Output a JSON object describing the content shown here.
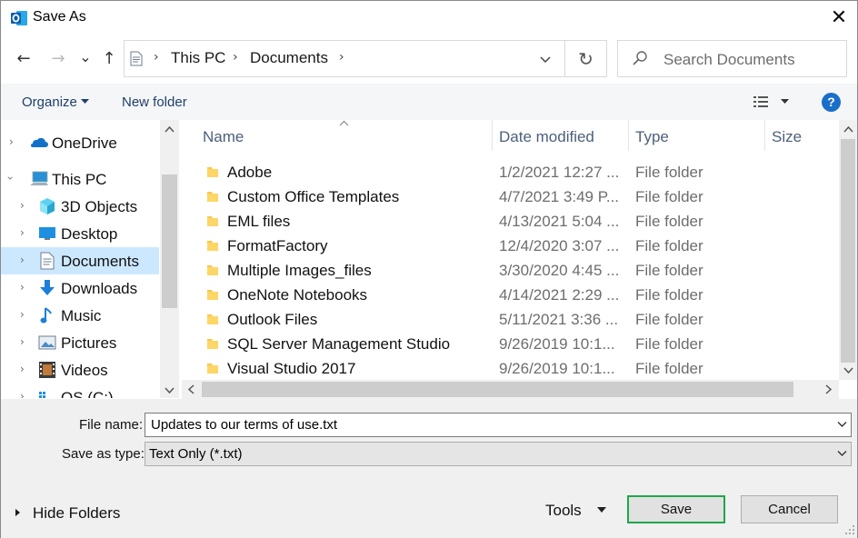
{
  "window": {
    "title": "Save As"
  },
  "nav": {
    "back_glyph": "←",
    "forward_glyph": "→",
    "recent_glyph": "⌄",
    "up_glyph": "↑",
    "refresh_glyph": "↻",
    "close_glyph": "✕"
  },
  "address": {
    "crumbs": [
      "This PC",
      "Documents"
    ],
    "separator": "›"
  },
  "search": {
    "placeholder": "Search Documents"
  },
  "commandbar": {
    "organize": "Organize",
    "new_folder": "New folder",
    "help": "?"
  },
  "navpane": {
    "items": [
      {
        "label": "OneDrive",
        "icon": "cloud-icon"
      },
      {
        "label": "This PC",
        "icon": "computer-icon"
      },
      {
        "label": "3D Objects",
        "icon": "cube-icon"
      },
      {
        "label": "Desktop",
        "icon": "desktop-icon"
      },
      {
        "label": "Documents",
        "icon": "document-icon",
        "selected": true
      },
      {
        "label": "Downloads",
        "icon": "download-arrow-icon"
      },
      {
        "label": "Music",
        "icon": "music-note-icon"
      },
      {
        "label": "Pictures",
        "icon": "picture-icon"
      },
      {
        "label": "Videos",
        "icon": "film-icon"
      },
      {
        "label": "OS (C:)",
        "icon": "drive-icon"
      }
    ]
  },
  "filelist": {
    "columns": {
      "name": "Name",
      "date": "Date modified",
      "type": "Type",
      "size": "Size"
    },
    "rows": [
      {
        "name": "Adobe",
        "date": "1/2/2021 12:27 ...",
        "type": "File folder"
      },
      {
        "name": "Custom Office Templates",
        "date": "4/7/2021 3:49 P...",
        "type": "File folder"
      },
      {
        "name": "EML files",
        "date": "4/13/2021 5:04 ...",
        "type": "File folder"
      },
      {
        "name": "FormatFactory",
        "date": "12/4/2020 3:07 ...",
        "type": "File folder"
      },
      {
        "name": "Multiple Images_files",
        "date": "3/30/2020 4:45 ...",
        "type": "File folder"
      },
      {
        "name": "OneNote Notebooks",
        "date": "4/14/2021 2:29 ...",
        "type": "File folder"
      },
      {
        "name": "Outlook Files",
        "date": "5/11/2021 3:36 ...",
        "type": "File folder"
      },
      {
        "name": "SQL Server Management Studio",
        "date": "9/26/2019 10:1...",
        "type": "File folder"
      },
      {
        "name": "Visual Studio 2017",
        "date": "9/26/2019 10:1...",
        "type": "File folder"
      }
    ]
  },
  "form": {
    "file_name_label": "File name:",
    "file_name_value": "Updates to our terms of use.txt",
    "save_type_label": "Save as type:",
    "save_type_value": "Text Only (*.txt)"
  },
  "footer": {
    "hide_folders": "Hide Folders",
    "tools": "Tools",
    "save": "Save",
    "cancel": "Cancel"
  },
  "colors": {
    "accent": "#1a6fc9",
    "selection": "#cce8ff",
    "default_button_border": "#21a64a",
    "folder": "#f8c84a"
  }
}
